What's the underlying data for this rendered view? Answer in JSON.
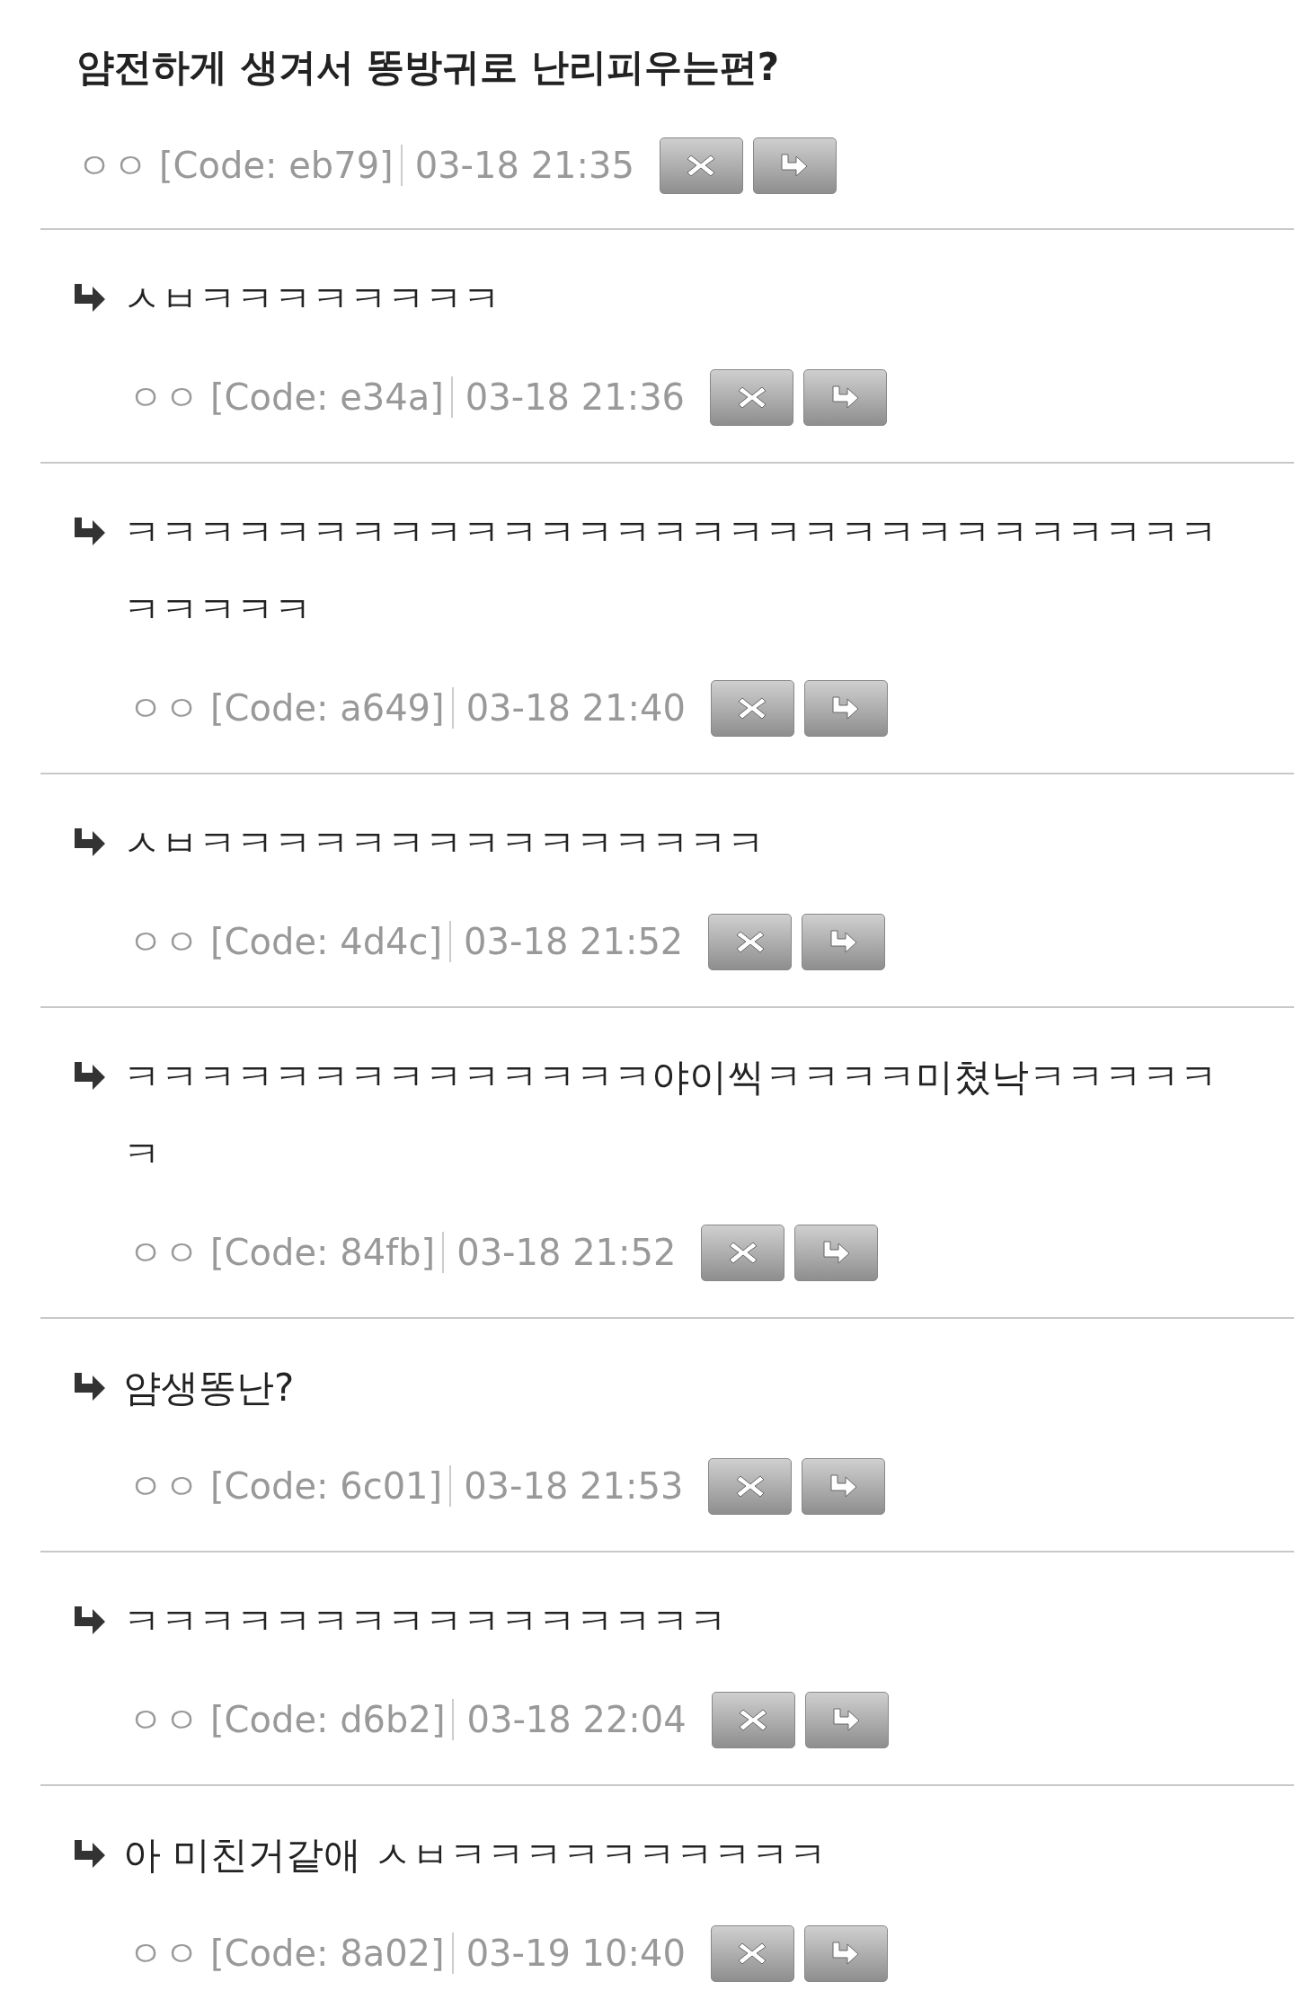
{
  "post": {
    "title": "얌전하게 생겨서 똥방귀로 난리피우는편?",
    "author": "ㅇㅇ",
    "code": "[Code: eb79]",
    "time": "03-18 21:35"
  },
  "replies": [
    {
      "text": "ㅅㅂㅋㅋㅋㅋㅋㅋㅋㅋ",
      "author": "ㅇㅇ",
      "code": "[Code: e34a]",
      "time": "03-18 21:36"
    },
    {
      "text": "ㅋㅋㅋㅋㅋㅋㅋㅋㅋㅋㅋㅋㅋㅋㅋㅋㅋㅋㅋㅋㅋㅋㅋㅋㅋㅋㅋㅋㅋㅋㅋㅋㅋㅋ",
      "author": "ㅇㅇ",
      "code": "[Code: a649]",
      "time": "03-18 21:40"
    },
    {
      "text": "ㅅㅂㅋㅋㅋㅋㅋㅋㅋㅋㅋㅋㅋㅋㅋㅋㅋ",
      "author": "ㅇㅇ",
      "code": "[Code: 4d4c]",
      "time": "03-18 21:52"
    },
    {
      "text": "ㅋㅋㅋㅋㅋㅋㅋㅋㅋㅋㅋㅋㅋㅋ야이씩ㅋㅋㅋㅋ미쳤낙ㅋㅋㅋㅋㅋㅋ",
      "author": "ㅇㅇ",
      "code": "[Code: 84fb]",
      "time": "03-18 21:52"
    },
    {
      "text": "얌생똥난?",
      "author": "ㅇㅇ",
      "code": "[Code: 6c01]",
      "time": "03-18 21:53"
    },
    {
      "text": "ㅋㅋㅋㅋㅋㅋㅋㅋㅋㅋㅋㅋㅋㅋㅋㅋ",
      "author": "ㅇㅇ",
      "code": "[Code: d6b2]",
      "time": "03-18 22:04"
    },
    {
      "text": "아 미친거같애 ㅅㅂㅋㅋㅋㅋㅋㅋㅋㅋㅋㅋ",
      "author": "ㅇㅇ",
      "code": "[Code: 8a02]",
      "time": "03-19 10:40"
    }
  ]
}
